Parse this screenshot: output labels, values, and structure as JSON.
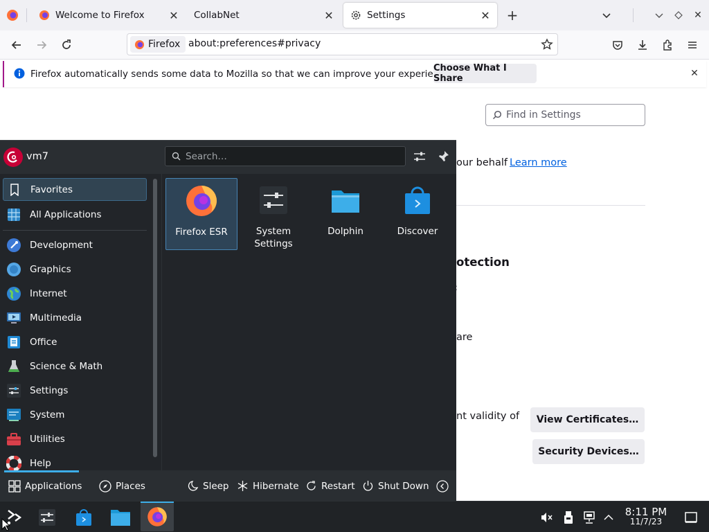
{
  "tabs": [
    {
      "label": "Welcome to Firefox",
      "icon": "firefox-icon"
    },
    {
      "label": "CollabNet"
    },
    {
      "label": "Settings",
      "icon": "gear-icon",
      "active": true
    }
  ],
  "urlbar": {
    "identity_label": "Firefox",
    "url": "about:preferences#privacy"
  },
  "notification": {
    "message": "Firefox automatically sends some data to Mozilla so that we can improve your experience.",
    "button": "Choose What I Share"
  },
  "settings": {
    "find_placeholder": "Find in Settings",
    "behalf_text": "our behalf",
    "learn_more": "Learn more",
    "protection_heading": "otection",
    "tiny_char": ":",
    "share_fragment": "are",
    "validity_fragment": "nt validity of",
    "view_certificates": "View Certificates…",
    "security_devices": "Security Devices…"
  },
  "kde_menu": {
    "user": "vm7",
    "search_placeholder": "Search…",
    "categories": [
      {
        "label": "Favorites",
        "icon": "bookmark-icon",
        "selected": true
      },
      {
        "label": "All Applications",
        "icon": "grid-icon"
      },
      {
        "label": "Development",
        "icon": "development-icon"
      },
      {
        "label": "Graphics",
        "icon": "graphics-icon"
      },
      {
        "label": "Internet",
        "icon": "globe-icon"
      },
      {
        "label": "Multimedia",
        "icon": "multimedia-icon"
      },
      {
        "label": "Office",
        "icon": "office-icon"
      },
      {
        "label": "Science & Math",
        "icon": "flask-icon"
      },
      {
        "label": "Settings",
        "icon": "settings-sliders-icon"
      },
      {
        "label": "System",
        "icon": "system-icon"
      },
      {
        "label": "Utilities",
        "icon": "toolbox-icon"
      },
      {
        "label": "Help",
        "icon": "lifebuoy-icon"
      }
    ],
    "apps": [
      {
        "label": "Firefox ESR",
        "icon": "firefox-icon",
        "selected": true
      },
      {
        "label": "System Settings",
        "icon": "system-settings-icon"
      },
      {
        "label": "Dolphin",
        "icon": "folder-icon"
      },
      {
        "label": "Discover",
        "icon": "discover-bag-icon"
      }
    ],
    "footer": {
      "applications": "Applications",
      "places": "Places",
      "sleep": "Sleep",
      "hibernate": "Hibernate",
      "restart": "Restart",
      "shutdown": "Shut Down"
    }
  },
  "taskbar": {
    "time": "8:11 PM",
    "date": "11/7/23"
  },
  "colors": {
    "kde_bg": "#222529",
    "kde_accent": "#3daee9",
    "firefox_link": "#0061e0",
    "notif_accent": "#a2188a"
  }
}
